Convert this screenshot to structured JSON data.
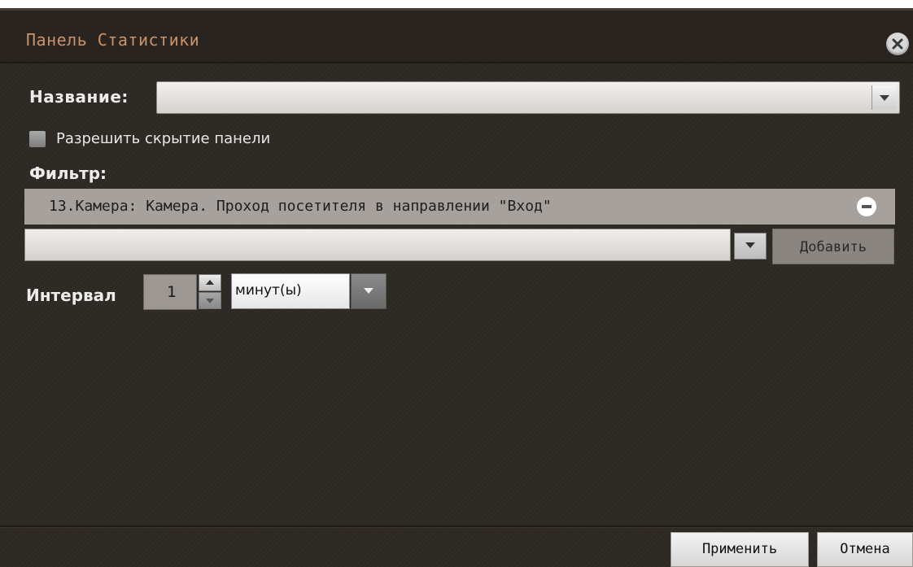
{
  "dialog": {
    "title": "Панель Статистики"
  },
  "form": {
    "name_label": "Название:",
    "name_value": "",
    "allow_hide_label": "Разрешить скрытие панели",
    "allow_hide_checked": false,
    "filter_label": "Фильтр:",
    "filter_items": [
      "13.Камера: Камера. Проход посетителя в направлении \"Вход\""
    ],
    "filter_input_value": "",
    "add_label": "Добавить",
    "interval_label": "Интервал",
    "interval_value": "1",
    "interval_unit": "минут(ы)"
  },
  "footer": {
    "apply_label": "Применить",
    "cancel_label": "Отмена"
  },
  "icons": {
    "close": "close-icon",
    "remove": "minus-circle-icon",
    "dropdown": "chevron-down-icon"
  }
}
